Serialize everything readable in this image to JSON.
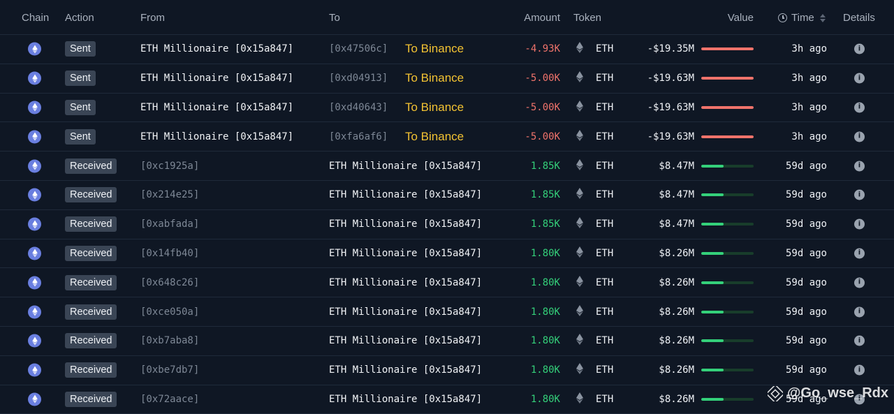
{
  "header": {
    "chain": "Chain",
    "action": "Action",
    "from": "From",
    "to": "To",
    "amount": "Amount",
    "token": "Token",
    "value": "Value",
    "time": "Time",
    "details": "Details"
  },
  "colors": {
    "negative": "#f0736b",
    "positive": "#34d07a",
    "label": "#f2c232",
    "chain_icon": "#6a7fe0"
  },
  "rows": [
    {
      "action": "Sent",
      "from": "ETH Millionaire [0x15a847]",
      "to": "[0x47506c]",
      "to_label": "To Binance",
      "amount": "-4.93K",
      "token": "ETH",
      "value": "-$19.35M",
      "bar_fraction": 1.0,
      "time": "3h ago",
      "direction": "out"
    },
    {
      "action": "Sent",
      "from": "ETH Millionaire [0x15a847]",
      "to": "[0xd04913]",
      "to_label": "To Binance",
      "amount": "-5.00K",
      "token": "ETH",
      "value": "-$19.63M",
      "bar_fraction": 1.0,
      "time": "3h ago",
      "direction": "out"
    },
    {
      "action": "Sent",
      "from": "ETH Millionaire [0x15a847]",
      "to": "[0xd40643]",
      "to_label": "To Binance",
      "amount": "-5.00K",
      "token": "ETH",
      "value": "-$19.63M",
      "bar_fraction": 1.0,
      "time": "3h ago",
      "direction": "out"
    },
    {
      "action": "Sent",
      "from": "ETH Millionaire [0x15a847]",
      "to": "[0xfa6af6]",
      "to_label": "To Binance",
      "amount": "-5.00K",
      "token": "ETH",
      "value": "-$19.63M",
      "bar_fraction": 1.0,
      "time": "3h ago",
      "direction": "out"
    },
    {
      "action": "Received",
      "from": "[0xc1925a]",
      "to": "ETH Millionaire [0x15a847]",
      "to_label": "",
      "amount": "1.85K",
      "token": "ETH",
      "value": "$8.47M",
      "bar_fraction": 0.43,
      "time": "59d ago",
      "direction": "in"
    },
    {
      "action": "Received",
      "from": "[0x214e25]",
      "to": "ETH Millionaire [0x15a847]",
      "to_label": "",
      "amount": "1.85K",
      "token": "ETH",
      "value": "$8.47M",
      "bar_fraction": 0.43,
      "time": "59d ago",
      "direction": "in"
    },
    {
      "action": "Received",
      "from": "[0xabfada]",
      "to": "ETH Millionaire [0x15a847]",
      "to_label": "",
      "amount": "1.85K",
      "token": "ETH",
      "value": "$8.47M",
      "bar_fraction": 0.43,
      "time": "59d ago",
      "direction": "in"
    },
    {
      "action": "Received",
      "from": "[0x14fb40]",
      "to": "ETH Millionaire [0x15a847]",
      "to_label": "",
      "amount": "1.80K",
      "token": "ETH",
      "value": "$8.26M",
      "bar_fraction": 0.42,
      "time": "59d ago",
      "direction": "in"
    },
    {
      "action": "Received",
      "from": "[0x648c26]",
      "to": "ETH Millionaire [0x15a847]",
      "to_label": "",
      "amount": "1.80K",
      "token": "ETH",
      "value": "$8.26M",
      "bar_fraction": 0.42,
      "time": "59d ago",
      "direction": "in"
    },
    {
      "action": "Received",
      "from": "[0xce050a]",
      "to": "ETH Millionaire [0x15a847]",
      "to_label": "",
      "amount": "1.80K",
      "token": "ETH",
      "value": "$8.26M",
      "bar_fraction": 0.42,
      "time": "59d ago",
      "direction": "in"
    },
    {
      "action": "Received",
      "from": "[0xb7aba8]",
      "to": "ETH Millionaire [0x15a847]",
      "to_label": "",
      "amount": "1.80K",
      "token": "ETH",
      "value": "$8.26M",
      "bar_fraction": 0.42,
      "time": "59d ago",
      "direction": "in"
    },
    {
      "action": "Received",
      "from": "[0xbe7db7]",
      "to": "ETH Millionaire [0x15a847]",
      "to_label": "",
      "amount": "1.80K",
      "token": "ETH",
      "value": "$8.26M",
      "bar_fraction": 0.42,
      "time": "59d ago",
      "direction": "in"
    },
    {
      "action": "Received",
      "from": "[0x72aace]",
      "to": "ETH Millionaire [0x15a847]",
      "to_label": "",
      "amount": "1.80K",
      "token": "ETH",
      "value": "$8.26M",
      "bar_fraction": 0.42,
      "time": "59d ago",
      "direction": "in"
    }
  ],
  "watermark": {
    "text": "@Go_wse_Rdx",
    "icon": "binance-logo-icon"
  }
}
